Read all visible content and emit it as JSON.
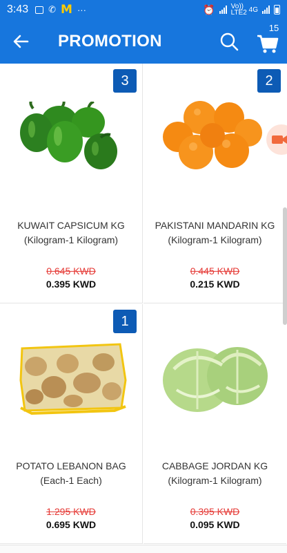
{
  "status_bar": {
    "time": "3:43",
    "network": "Vo)) LTE2",
    "network_type": "4G",
    "icons": [
      "image-icon",
      "phone-icon",
      "mcdonalds-icon",
      "more-icon",
      "alarm-icon",
      "signal-icon",
      "signal2-icon",
      "battery-icon"
    ]
  },
  "app_bar": {
    "title": "PROMOTION",
    "cart_count": "15",
    "icons": [
      "back-arrow-icon",
      "search-icon",
      "cart-icon"
    ]
  },
  "colors": {
    "primary": "#1776dd",
    "badge": "#0d5bb5",
    "old_price": "#e53935"
  },
  "products": [
    {
      "qty": "3",
      "name": "KUWAIT CAPSICUM KG (Kilogram-1 Kilogram)",
      "old_price": "0.645 KWD",
      "new_price": "0.395 KWD",
      "icon": "green-capsicum-image"
    },
    {
      "qty": "2",
      "name": "PAKISTANI  MANDARIN KG (Kilogram-1 Kilogram)",
      "old_price": "0.445 KWD",
      "new_price": "0.215 KWD",
      "icon": "mandarin-oranges-image"
    },
    {
      "qty": "1",
      "name": "POTATO LEBANON BAG (Each-1 Each)",
      "old_price": "1.295 KWD",
      "new_price": "0.695 KWD",
      "icon": "potato-bag-image"
    },
    {
      "qty": "",
      "name": "CABBAGE JORDAN KG (Kilogram-1 Kilogram)",
      "old_price": "0.395 KWD",
      "new_price": "0.095 KWD",
      "icon": "cabbage-image"
    }
  ]
}
